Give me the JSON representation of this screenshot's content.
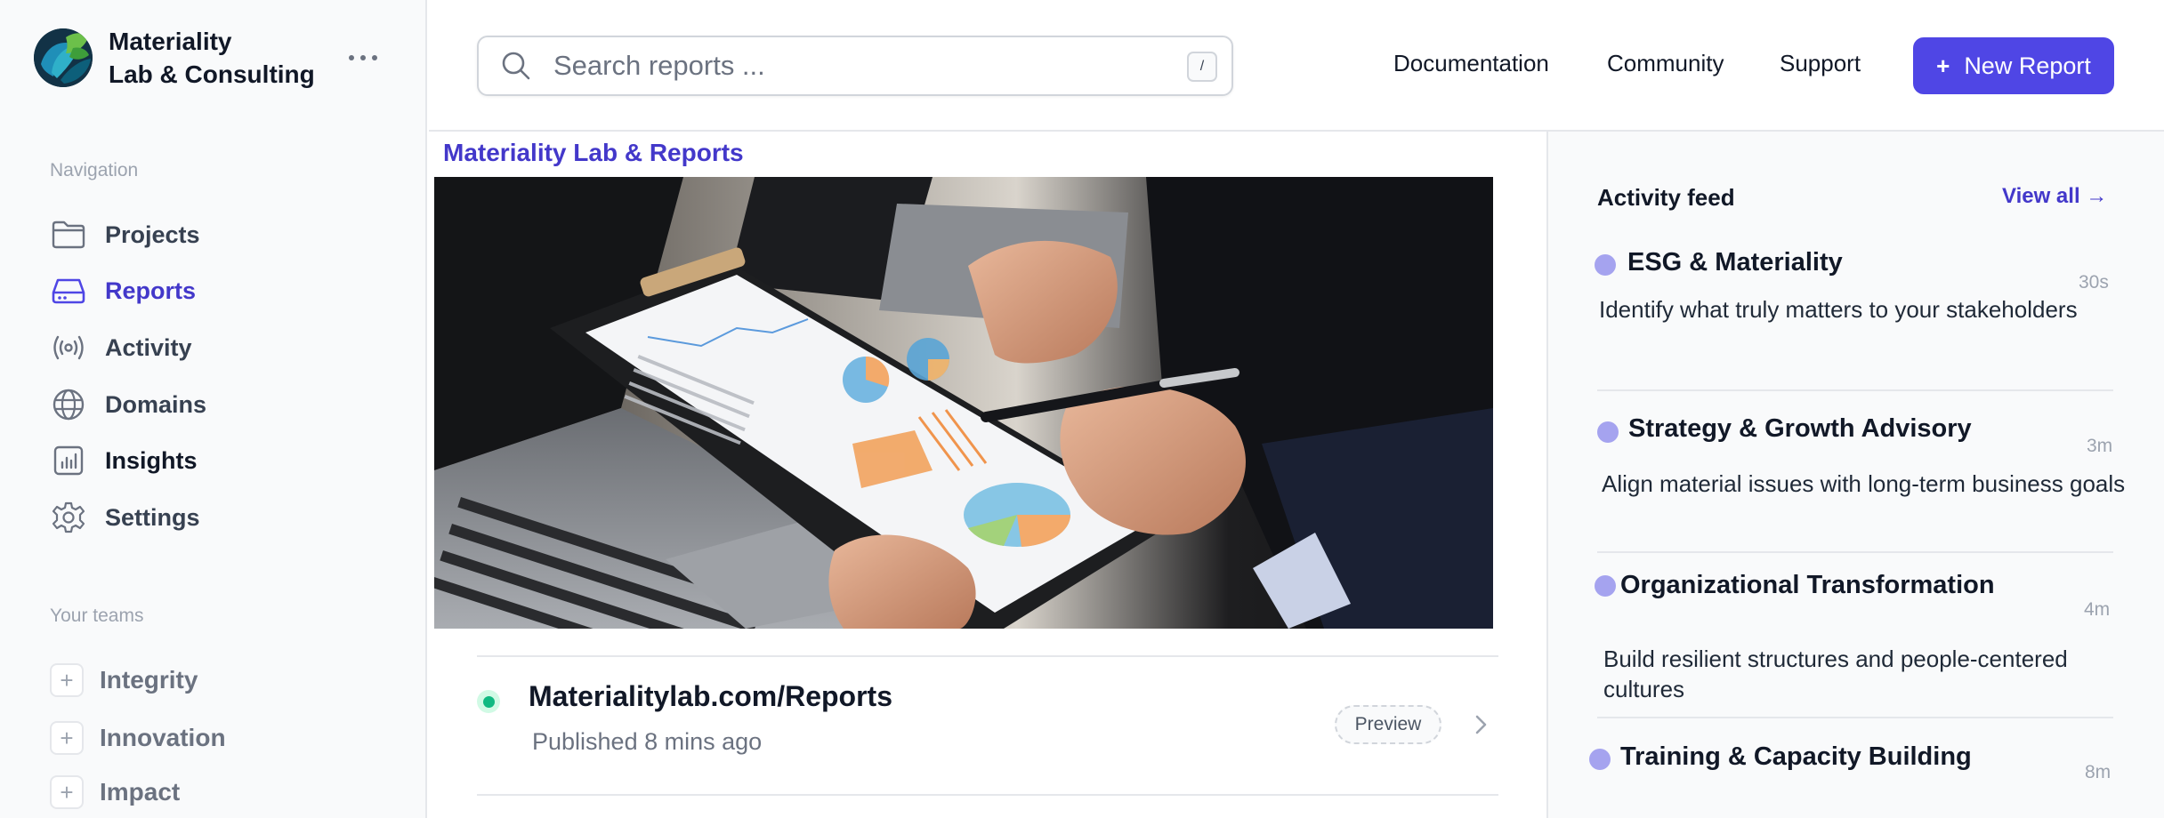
{
  "brand": {
    "name_line1": "Materiality",
    "name_line2": "Lab & Consulting"
  },
  "sidebar": {
    "nav_label": "Navigation",
    "items": [
      {
        "label": "Projects",
        "icon": "folder-icon"
      },
      {
        "label": "Reports",
        "icon": "drive-icon"
      },
      {
        "label": "Activity",
        "icon": "broadcast-icon"
      },
      {
        "label": "Domains",
        "icon": "globe-icon"
      },
      {
        "label": "Insights",
        "icon": "bar-chart-icon"
      },
      {
        "label": "Settings",
        "icon": "gear-icon"
      }
    ],
    "active_item": "Reports",
    "teams_label": "Your teams",
    "teams": [
      {
        "label": "Integrity"
      },
      {
        "label": "Innovation"
      },
      {
        "label": "Impact"
      }
    ]
  },
  "header": {
    "search_placeholder": "Search reports ...",
    "search_shortcut": "/",
    "links": [
      {
        "label": "Documentation"
      },
      {
        "label": "Community"
      },
      {
        "label": "Support"
      }
    ],
    "new_report_label": "New Report"
  },
  "main": {
    "title": "Materiality Lab & Reports",
    "deployment": {
      "title": "Materialitylab.com/Reports",
      "subtitle": "Published 8 mins ago",
      "preview_label": "Preview",
      "status_color": "#10b981"
    }
  },
  "feed": {
    "title": "Activity feed",
    "view_all": "View all →",
    "items": [
      {
        "title": "ESG & Materiality",
        "time": "30s",
        "desc": "Identify what truly matters to your stakeholders"
      },
      {
        "title": "Strategy & Growth Advisory",
        "time": "3m",
        "desc": "Align material issues with long-term business goals"
      },
      {
        "title": "Organizational Transformation",
        "time": "4m",
        "desc": "Build resilient structures and people-centered cultures"
      },
      {
        "title": "Training & Capacity Building",
        "time": "8m",
        "desc": ""
      }
    ]
  },
  "colors": {
    "accent": "#4f46e5",
    "accent_text": "#4338ca",
    "feed_dot": "#a5a3ef"
  }
}
